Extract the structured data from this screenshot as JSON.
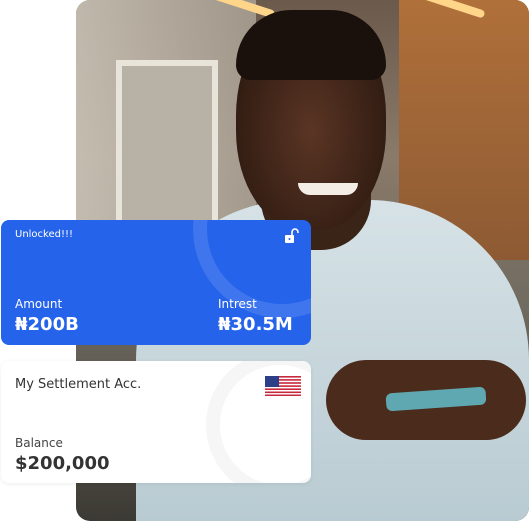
{
  "photo": {
    "description_icon": "smiling-man-with-phone-photo"
  },
  "loan_card": {
    "status": "Unlocked!!!",
    "status_icon": "unlock-icon",
    "amount_label": "Amount",
    "amount_value": "₦200B",
    "interest_label": "Intrest",
    "interest_value": "₦30.5M",
    "color": "#2563eb"
  },
  "account_card": {
    "title": "My Settlement Acc.",
    "flag_icon": "us-flag-icon",
    "balance_label": "Balance",
    "balance_value": "$200,000"
  }
}
